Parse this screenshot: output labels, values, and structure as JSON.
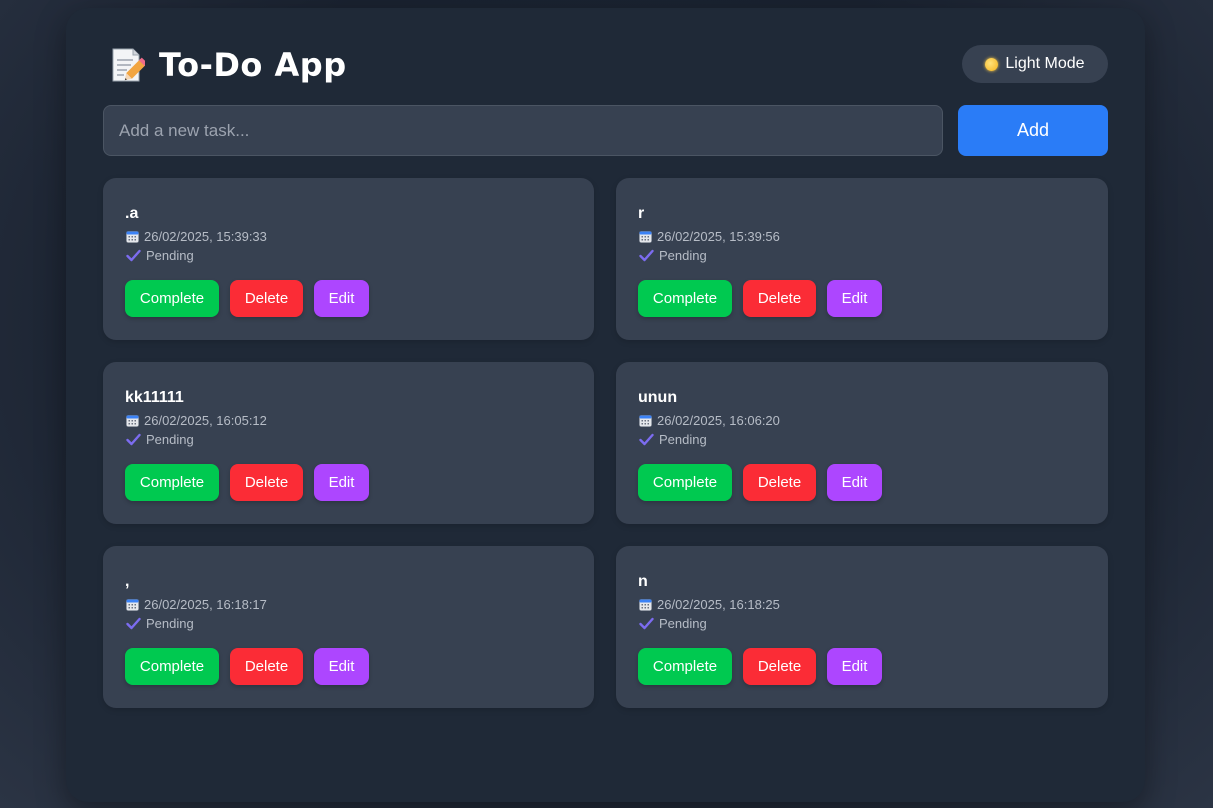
{
  "app": {
    "title": "To-Do App",
    "title_icon": "memo-icon",
    "theme_toggle_label": "Light Mode",
    "theme_toggle_icon": "sun-icon"
  },
  "input": {
    "placeholder": "Add a new task...",
    "value": "",
    "add_label": "Add"
  },
  "colors": {
    "add": "#2a7cf7",
    "complete": "#00c950",
    "delete": "#fb2c36",
    "edit": "#ad46ff"
  },
  "tasks": [
    {
      "title": ".a",
      "date": "26/02/2025, 15:39:33",
      "status": "Pending",
      "complete_label": "Complete",
      "delete_label": "Delete",
      "edit_label": "Edit"
    },
    {
      "title": "r",
      "date": "26/02/2025, 15:39:56",
      "status": "Pending",
      "complete_label": "Complete",
      "delete_label": "Delete",
      "edit_label": "Edit"
    },
    {
      "title": "kk11111",
      "date": "26/02/2025, 16:05:12",
      "status": "Pending",
      "complete_label": "Complete",
      "delete_label": "Delete",
      "edit_label": "Edit"
    },
    {
      "title": "unun",
      "date": "26/02/2025, 16:06:20",
      "status": "Pending",
      "complete_label": "Complete",
      "delete_label": "Delete",
      "edit_label": "Edit"
    },
    {
      "title": ",",
      "date": "26/02/2025, 16:18:17",
      "status": "Pending",
      "complete_label": "Complete",
      "delete_label": "Delete",
      "edit_label": "Edit"
    },
    {
      "title": "n",
      "date": "26/02/2025, 16:18:25",
      "status": "Pending",
      "complete_label": "Complete",
      "delete_label": "Delete",
      "edit_label": "Edit"
    }
  ]
}
